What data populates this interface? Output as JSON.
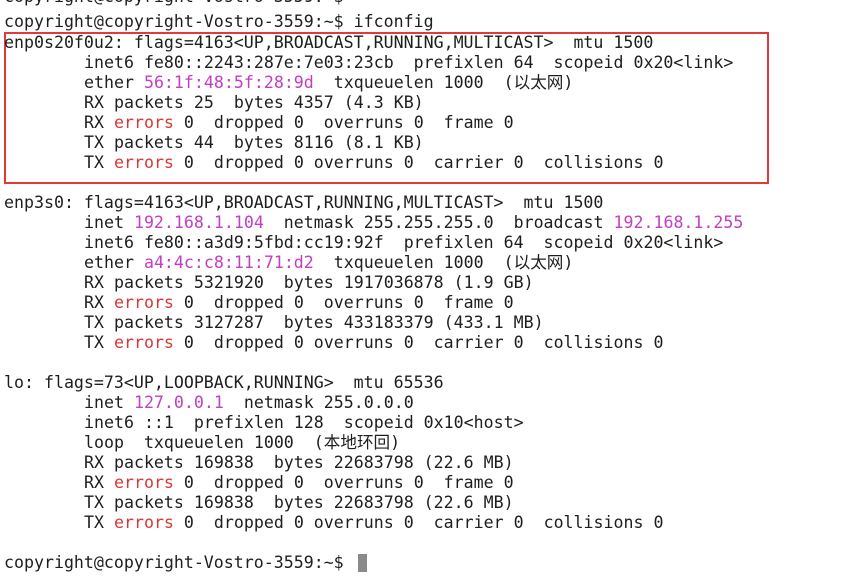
{
  "terminal": {
    "prompt": "copyright@copyright-Vostro-3559:~$",
    "command": "ifconfig",
    "interfaces": [
      {
        "header": "enp0s20f0u2: flags=4163<UP,BROADCAST,RUNNING,MULTICAST>  mtu 1500",
        "inet6": {
          "pre": "inet6 fe80::2243:287e:7e03:23cb  prefixlen 64  scopeid 0x20<link>"
        },
        "ether": {
          "pre": "ether ",
          "mac": "56:1f:48:5f:28:9d",
          "post": "  txqueuelen 1000  (以太网)"
        },
        "rx_packets": "RX packets 25  bytes 4357 (4.3 KB)",
        "rx_errors": {
          "pre": "RX ",
          "err": "errors",
          "post": " 0  dropped 0  overruns 0  frame 0"
        },
        "tx_packets": "TX packets 44  bytes 8116 (8.1 KB)",
        "tx_errors": {
          "pre": "TX ",
          "err": "errors",
          "post": " 0  dropped 0 overruns 0  carrier 0  collisions 0"
        }
      },
      {
        "header": "enp3s0: flags=4163<UP,BROADCAST,RUNNING,MULTICAST>  mtu 1500",
        "inet": {
          "pre": "inet ",
          "ip": "192.168.1.104",
          "mid": "  netmask 255.255.255.0  broadcast ",
          "bcast": "192.168.1.255"
        },
        "inet6": {
          "pre": "inet6 fe80::a3d9:5fbd:cc19:92f  prefixlen 64  scopeid 0x20<link>"
        },
        "ether": {
          "pre": "ether ",
          "mac": "a4:4c:c8:11:71:d2",
          "post": "  txqueuelen 1000  (以太网)"
        },
        "rx_packets": "RX packets 5321920  bytes 1917036878 (1.9 GB)",
        "rx_errors": {
          "pre": "RX ",
          "err": "errors",
          "post": " 0  dropped 0  overruns 0  frame 0"
        },
        "tx_packets": "TX packets 3127287  bytes 433183379 (433.1 MB)",
        "tx_errors": {
          "pre": "TX ",
          "err": "errors",
          "post": " 0  dropped 0 overruns 0  carrier 0  collisions 0"
        }
      },
      {
        "header": "lo: flags=73<UP,LOOPBACK,RUNNING>  mtu 65536",
        "inet": {
          "pre": "inet ",
          "ip": "127.0.0.1",
          "mid": "  netmask 255.0.0.0"
        },
        "inet6": {
          "pre": "inet6 ::1  prefixlen 128  scopeid 0x10<host>"
        },
        "loop": "loop  txqueuelen 1000  (本地环回)",
        "rx_packets": "RX packets 169838  bytes 22683798 (22.6 MB)",
        "rx_errors": {
          "pre": "RX ",
          "err": "errors",
          "post": " 0  dropped 0  overruns 0  frame 0"
        },
        "tx_packets": "TX packets 169838  bytes 22683798 (22.6 MB)",
        "tx_errors": {
          "pre": "TX ",
          "err": "errors",
          "post": " 0  dropped 0 overruns 0  carrier 0  collisions 0"
        }
      }
    ]
  },
  "colors": {
    "highlight_mac_ip": "#c43dc4",
    "errors_word": "#d63838",
    "highlight_box": "#e23a3a"
  }
}
